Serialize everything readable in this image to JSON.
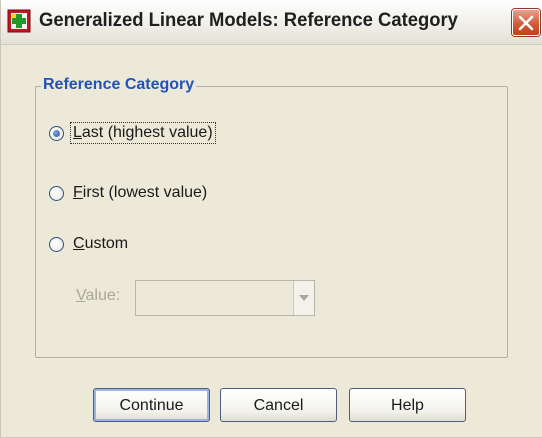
{
  "window": {
    "title": "Generalized Linear Models: Reference Category",
    "icon": "app-icon",
    "close_icon": "close-icon"
  },
  "reference_category": {
    "group_label": "Reference Category",
    "options": [
      {
        "label": "Last (highest value)",
        "mnemonic": "L",
        "selected": true
      },
      {
        "label": "First (lowest value)",
        "mnemonic": "F",
        "selected": false
      },
      {
        "label": "Custom",
        "mnemonic": "C",
        "selected": false
      }
    ],
    "value_label": "Value:",
    "value_mnemonic": "V",
    "value": ""
  },
  "buttons": {
    "continue": "Continue",
    "cancel": "Cancel",
    "help": "Help"
  },
  "colors": {
    "dialog_bg": "#ece9d8",
    "group_label": "#2352b8",
    "close_button": "#cf5733",
    "disabled_text": "#a9a89c"
  }
}
